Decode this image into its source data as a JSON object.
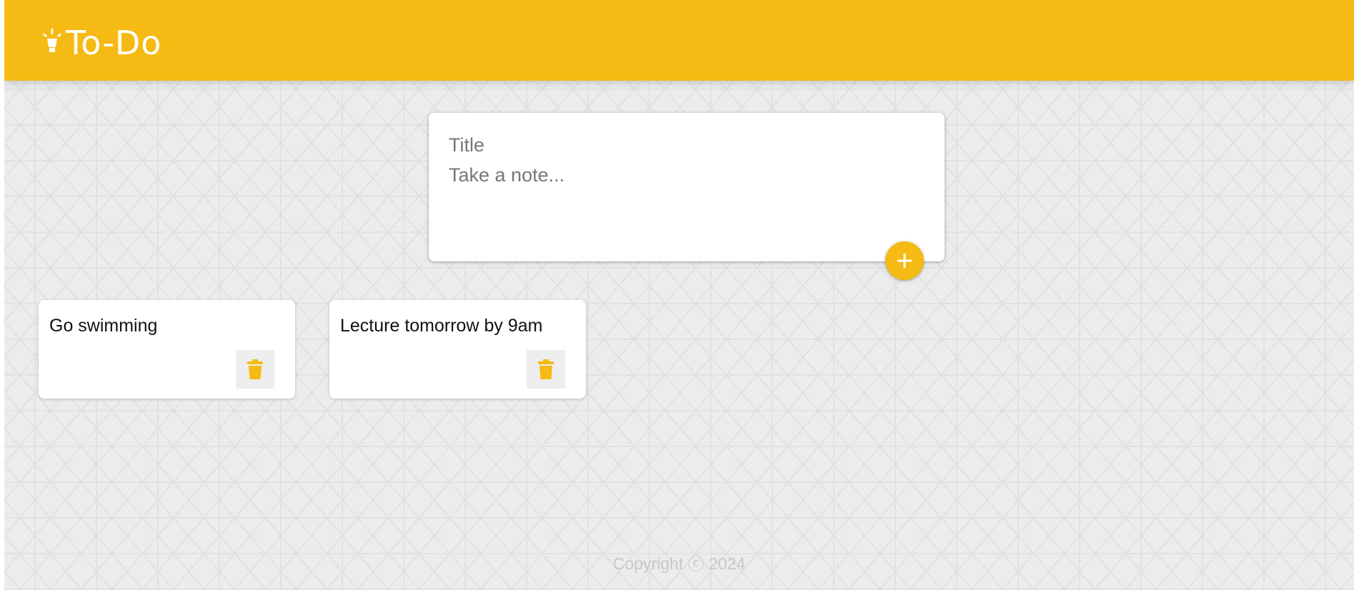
{
  "header": {
    "title": "To-Do",
    "logo_icon": "lightbulb-icon",
    "color": "#f5ba13"
  },
  "create_note": {
    "title_placeholder": "Title",
    "content_placeholder": "Take a note...",
    "add_icon": "plus-icon"
  },
  "notes": [
    {
      "title": "Go swimming",
      "delete_icon": "trash-icon"
    },
    {
      "title": "Lecture tomorrow by 9am",
      "delete_icon": "trash-icon"
    }
  ],
  "footer": {
    "copyright": "Copyright ⓒ 2024"
  },
  "colors": {
    "accent": "#f5ba13",
    "background": "#ececec",
    "card": "#ffffff"
  }
}
